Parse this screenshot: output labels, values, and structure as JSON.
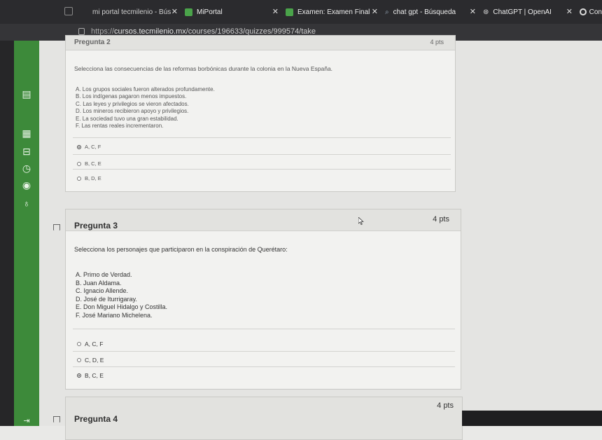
{
  "tabs": [
    {
      "label": "mi portal tecmilenio - Bús",
      "icon": "google-icon"
    },
    {
      "label": "MiPortal",
      "icon": "tecmilenio-icon"
    },
    {
      "label": "Examen: Examen Final",
      "icon": "tecmilenio-icon"
    },
    {
      "label": "chat gpt - Búsqueda",
      "icon": "search-icon"
    },
    {
      "label": "ChatGPT | OpenAI",
      "icon": "openai-icon"
    },
    {
      "label": "Con",
      "icon": "circle-icon"
    }
  ],
  "address": {
    "prefix": "https://",
    "host": "cursos.tecmilenio.mx",
    "path": "/courses/196633/quizzes/999574/take"
  },
  "question2": {
    "title": "Pregunta 2",
    "points": "4 pts",
    "prompt": "Selecciona las consecuencias de las reformas borbónicas durante la colonia en la Nueva España.",
    "options": [
      "A. Los grupos sociales fueron alterados profundamente.",
      "B. Los indígenas pagaron menos impuestos.",
      "C. Las leyes y privilegios se vieron afectados.",
      "D. Los mineros recibieron apoyo y privilegios.",
      "E. La sociedad tuvo una gran estabilidad.",
      "F. Las rentas reales incrementaron."
    ],
    "answers": [
      {
        "label": "A, C, F",
        "selected": true
      },
      {
        "label": "B, C, E",
        "selected": false
      },
      {
        "label": "B, D, E",
        "selected": false
      }
    ]
  },
  "question3": {
    "title": "Pregunta 3",
    "points": "4 pts",
    "prompt": "Selecciona los personajes que participaron en la conspiración de Querétaro:",
    "options": [
      "A. Primo de Verdad.",
      "B. Juan Aldama.",
      "C. Ignacio Allende.",
      "D. José de Iturrigaray.",
      "E. Don Miguel Hidalgo y Costilla.",
      "F. José Mariano Michelena."
    ],
    "answers": [
      {
        "label": "A, C, F",
        "selected": false
      },
      {
        "label": "C, D, E",
        "selected": false
      },
      {
        "label": "B, C, E",
        "selected": true
      }
    ]
  },
  "question4": {
    "title": "Pregunta 4",
    "points": "4 pts"
  },
  "colors": {
    "nav_green": "#3d8a3a",
    "tab_bg": "#2b2b2e"
  }
}
